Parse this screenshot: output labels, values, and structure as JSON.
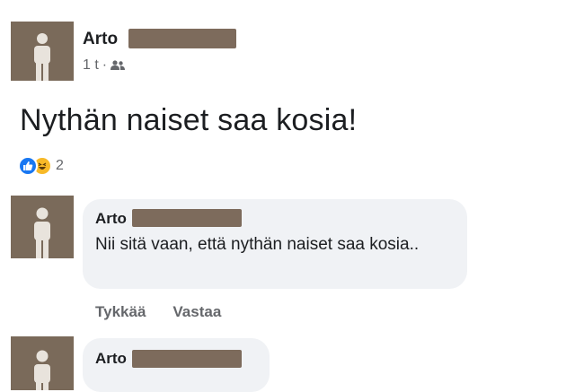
{
  "post": {
    "author": "Arto",
    "time": "1 t",
    "separator": "·",
    "audience_icon": "friends-icon",
    "text": "Nythän naiset saa kosia!",
    "reactions": {
      "icons": [
        "like-icon",
        "haha-icon"
      ],
      "count": "2"
    }
  },
  "comments": [
    {
      "author": "Arto",
      "text": "Nii sitä vaan, että nythän naiset saa kosia..",
      "actions": {
        "like": "Tykkää",
        "reply": "Vastaa"
      }
    },
    {
      "author": "Arto"
    }
  ],
  "colors": {
    "avatar_bg": "#7a6a5a",
    "redaction": "#7d6b5c",
    "bubble": "#f0f2f5",
    "secondary_text": "#65676b",
    "like_blue": "#1877f2",
    "haha_yellow": "#f7b928"
  }
}
